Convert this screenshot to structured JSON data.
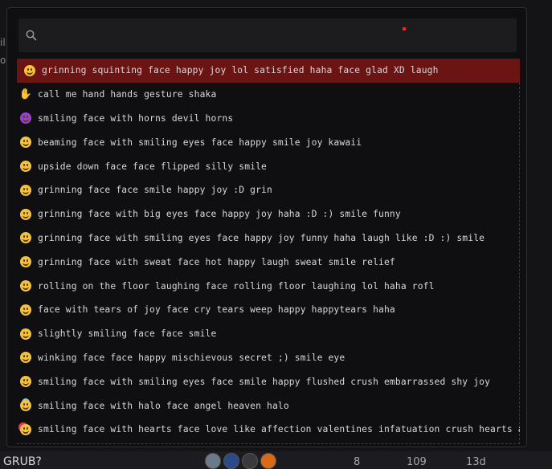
{
  "background": {
    "bottom_row": {
      "title": "GRUB?",
      "replies": "8",
      "views": "109",
      "activity": "13d"
    },
    "left_fragments": [
      "il",
      "o"
    ]
  },
  "search": {
    "placeholder": "",
    "value": ""
  },
  "emoji_list": [
    {
      "emoji": "grinning-squinting-face",
      "label": "grinning squinting face happy joy lol satisfied haha face glad XD laugh",
      "selected": true
    },
    {
      "emoji": "call-me-hand",
      "label": "call me hand hands gesture shaka",
      "selected": false
    },
    {
      "emoji": "smiling-face-with-horns",
      "label": "smiling face with horns devil horns",
      "selected": false
    },
    {
      "emoji": "beaming-face",
      "label": "beaming face with smiling eyes face happy smile joy kawaii",
      "selected": false
    },
    {
      "emoji": "upside-down-face",
      "label": "upside down face face flipped silly smile",
      "selected": false
    },
    {
      "emoji": "grinning-face",
      "label": "grinning face face smile happy joy :D grin",
      "selected": false
    },
    {
      "emoji": "grinning-face-big-eyes",
      "label": "grinning face with big eyes face happy joy haha :D :) smile funny",
      "selected": false
    },
    {
      "emoji": "grinning-face-smiling-eyes",
      "label": "grinning face with smiling eyes face happy joy funny haha laugh like :D :) smile",
      "selected": false
    },
    {
      "emoji": "grinning-face-sweat",
      "label": "grinning face with sweat face hot happy laugh sweat smile relief",
      "selected": false
    },
    {
      "emoji": "rolling-on-floor-laughing",
      "label": "rolling on the floor laughing face rolling floor laughing lol haha rofl",
      "selected": false
    },
    {
      "emoji": "face-with-tears-of-joy",
      "label": "face with tears of joy face cry tears weep happy happytears haha",
      "selected": false
    },
    {
      "emoji": "slightly-smiling-face",
      "label": "slightly smiling face face smile",
      "selected": false
    },
    {
      "emoji": "winking-face",
      "label": "winking face face happy mischievous secret ;) smile eye",
      "selected": false
    },
    {
      "emoji": "smiling-face-smiling-eyes",
      "label": "smiling face with smiling eyes face smile happy flushed crush embarrassed shy joy",
      "selected": false
    },
    {
      "emoji": "smiling-face-with-halo",
      "label": "smiling face with halo face angel heaven halo",
      "selected": false
    },
    {
      "emoji": "smiling-face-with-hearts",
      "label": "smiling face with hearts face love like affection valentines infatuation crush hearts add",
      "selected": false
    }
  ],
  "colors": {
    "selected_row": "#6b1414",
    "face_yellow": "#f5c33b",
    "devil_purple": "#9b3fd1"
  }
}
